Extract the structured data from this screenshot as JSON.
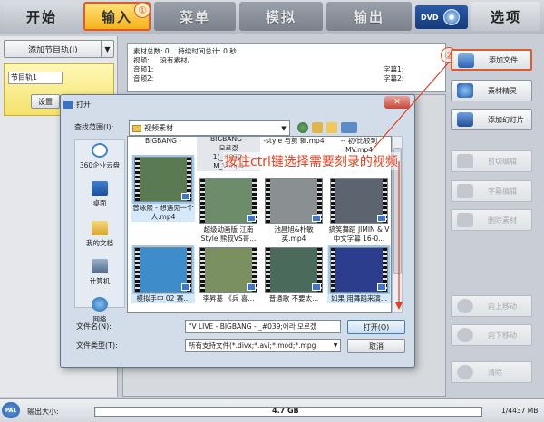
{
  "tabs": {
    "start": "开始",
    "input": "输入",
    "menu": "菜单",
    "preview": "模拟",
    "output": "输出",
    "dvd_label": "DVD",
    "options": "选项",
    "step1_marker": "①"
  },
  "left_panel": {
    "add_track": "添加节目轨(I)",
    "track_name": "节目轨1",
    "settings_btn": "设置"
  },
  "info_panel": {
    "total_label": "素材总数: 0",
    "duration_label": "持续时间总计: 0 秒",
    "video_label": "视频:",
    "video_value": "没有素材。",
    "audio1": "音频1:",
    "audio2": "音频2:",
    "sub1": "字幕1:",
    "sub2": "字幕2:"
  },
  "right_buttons": {
    "step2_marker": "②",
    "add_file": "添加文件",
    "material_wizard": "素材精灵",
    "add_slideshow": "添加幻灯片",
    "cut_edit": "剪切编辑",
    "subtitle_edit": "字幕编辑",
    "delete_material": "删除素材",
    "move_up": "向上移动",
    "move_down": "向下移动",
    "clear": "清除"
  },
  "dialog": {
    "title": "打开",
    "close": "✕",
    "look_in_label": "查找范围(I):",
    "look_in_value": "视频素材",
    "places": [
      "360企业云盘",
      "桌面",
      "我的文档",
      "计算机",
      "网络"
    ],
    "top_row_text": [
      "BIGBANG -",
      "BIGBANG -\n모르겠\n1)_#039;\nM_V.mp4",
      "-style 与剪\n辑.mp4",
      "-- 初/比较到\nMV.mp4"
    ],
    "files": [
      {
        "name": "曾咏熙 - 想遇见一个人.mp4",
        "color": "#5a7a54"
      },
      {
        "name": "超级动画版 江南Style 熊叔VS哥...",
        "color": "#6d8c6a"
      },
      {
        "name": "池昌旭&朴敏英.mp4",
        "color": "#8a8f92"
      },
      {
        "name": "搞笑舞蹈 JIMIN & V 中文字幕 16-0...",
        "color": "#5c6470"
      },
      {
        "name": "模拟手中 02 赛...",
        "color": "#3e8cc9"
      },
      {
        "name": "李昇基 《兵 喜...",
        "color": "#7a9060"
      },
      {
        "name": "普通歌 不要太...",
        "color": "#4a6a5c"
      },
      {
        "name": "如果 用舞蹈来演...",
        "color": "#2c3d8e"
      }
    ],
    "file_name_label": "文件名(N):",
    "file_name_value": "\"V LIVE - BIGBANG - _#039;에라 모르겠",
    "file_type_label": "文件类型(T):",
    "file_type_value": "所有支持文件(*.divx;*.avi;*.mod;*.mpg",
    "open_btn": "打开(O)",
    "cancel_btn": "取消"
  },
  "annotation": "按住ctrl键选择需要刻录的视频",
  "status": {
    "pal": "PAL",
    "output_label": "输出大小:",
    "capacity": "4.7 GB",
    "used_fraction": 0.0002,
    "size": "1/4437 MB"
  },
  "colors": {
    "accent": "#f4b21a",
    "annotation": "#e8401e"
  }
}
